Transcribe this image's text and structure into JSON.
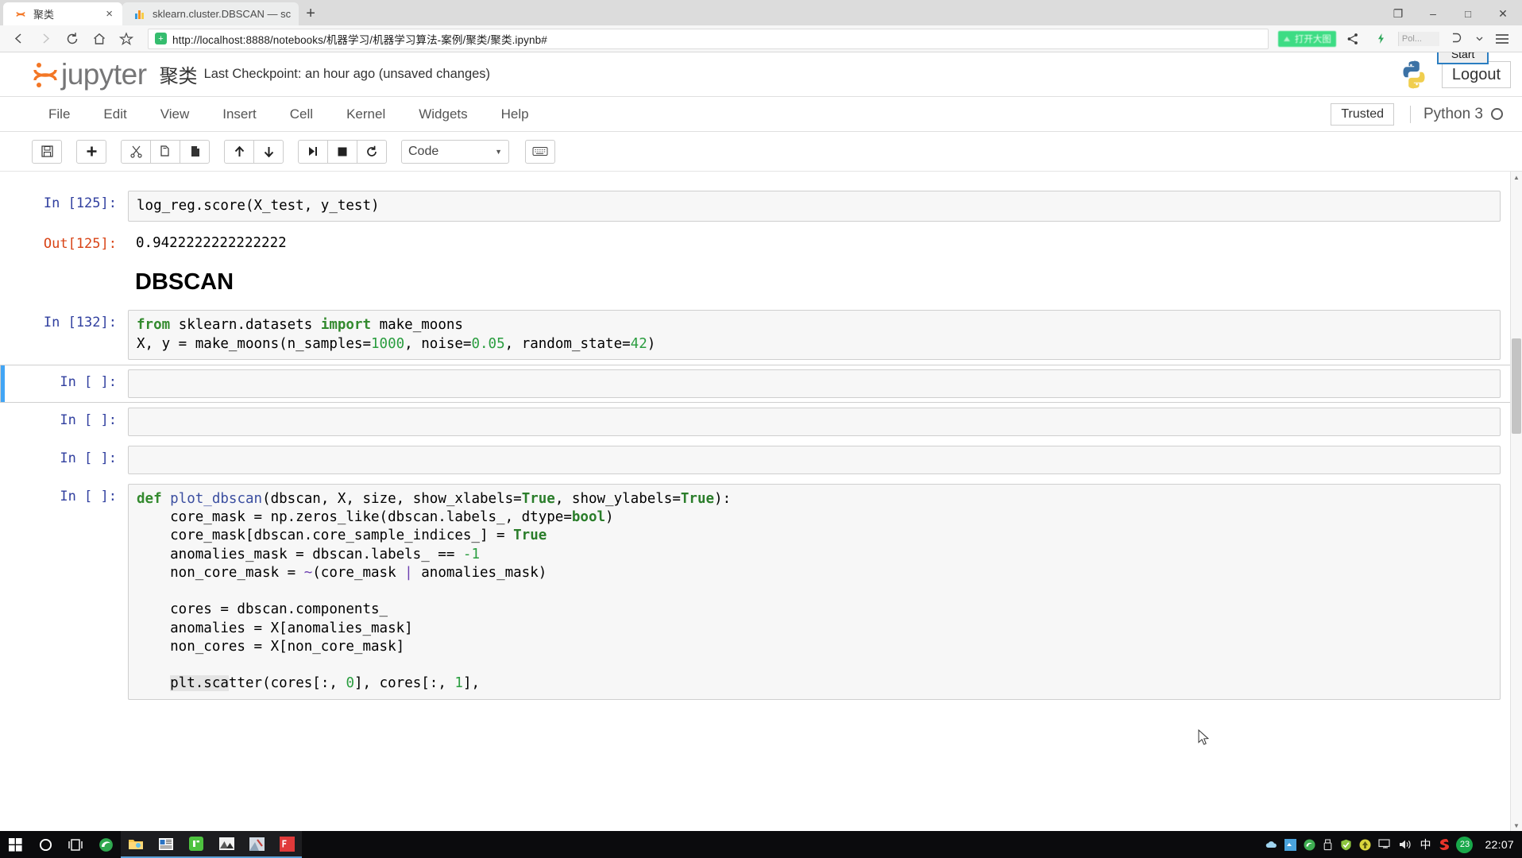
{
  "browser": {
    "tabs": [
      {
        "title": "聚类",
        "favicon": "jupyter-favicon",
        "active": true,
        "close_label": "×"
      },
      {
        "title": "sklearn.cluster.DBSCAN — sc",
        "favicon": "scikit-favicon",
        "active": false,
        "close_label": ""
      }
    ],
    "new_tab_label": "+",
    "nav": {
      "back_label": "‹",
      "forward_label": "›",
      "reload_label": "⟳",
      "home_label": "⌂",
      "bookmark_label": "☆",
      "url": "http://localhost:8888/notebooks/机器学习/机器学习算法-案例/聚类/聚类.ipynb#",
      "url_scheme": "http://",
      "url_host": "localhost",
      "url_path": ":8888/notebooks/机器学习/机器学习算法-案例/聚类/聚类.ipynb#",
      "security_icon": "shield-icon",
      "extension_badge": "打开大图",
      "share_icon": "share-icon",
      "lightning_icon": "lightning-icon",
      "pocket_label": "Pol...",
      "collections_icon": "collections-icon",
      "menu_icon": "hamburger-menu-icon"
    },
    "window_controls": {
      "restore_down": "❐",
      "minimize": "–",
      "maximize": "□",
      "close": "✕"
    }
  },
  "jupyter": {
    "logo_text": "jupyter",
    "notebook_name": "聚类",
    "checkpoint": "Last Checkpoint: an hour ago (unsaved changes)",
    "logout_label": "Logout",
    "start_tooltip": "Start",
    "menus": [
      "File",
      "Edit",
      "View",
      "Insert",
      "Cell",
      "Kernel",
      "Widgets",
      "Help"
    ],
    "trusted_label": "Trusted",
    "kernel_name": "Python 3",
    "kernel_status": "idle-circle-icon",
    "toolbar": {
      "save_icon": "save-icon",
      "insert_icon": "add-cell-icon",
      "cut_icon": "cut-icon",
      "copy_icon": "copy-icon",
      "paste_icon": "paste-icon",
      "move_up_icon": "arrow-up-icon",
      "move_down_icon": "arrow-down-icon",
      "run_icon": "run-cell-icon",
      "stop_icon": "stop-icon",
      "restart_icon": "restart-kernel-icon",
      "cell_type": "Code",
      "cell_type_caret": "▼",
      "keyboard_icon": "command-palette-icon"
    }
  },
  "notebook": {
    "cells": [
      {
        "id": "cell-score",
        "type": "code",
        "prompt": "In [125]:",
        "source": "log_reg.score(X_test, y_test)",
        "selected": false
      },
      {
        "id": "cell-score-output",
        "type": "output",
        "prompt": "Out[125]:",
        "text": "0.9422222222222222"
      },
      {
        "id": "cell-dbscan-heading",
        "type": "markdown",
        "heading": "DBSCAN"
      },
      {
        "id": "cell-make-moons",
        "type": "code",
        "prompt": "In [132]:",
        "lines": [
          "from sklearn.datasets import make_moons",
          "X, y = make_moons(n_samples=1000, noise=0.05, random_state=42)"
        ],
        "selected": false
      },
      {
        "id": "cell-empty-1",
        "type": "code",
        "prompt": "In [ ]:",
        "source": "",
        "selected": true
      },
      {
        "id": "cell-empty-2",
        "type": "code",
        "prompt": "In [ ]:",
        "source": "",
        "selected": false
      },
      {
        "id": "cell-empty-3",
        "type": "code",
        "prompt": "In [ ]:",
        "source": "",
        "selected": false
      },
      {
        "id": "cell-plot-dbscan",
        "type": "code",
        "prompt": "In [ ]:",
        "lines": [
          "def plot_dbscan(dbscan, X, size, show_xlabels=True, show_ylabels=True):",
          "    core_mask = np.zeros_like(dbscan.labels_, dtype=bool)",
          "    core_mask[dbscan.core_sample_indices_] = True",
          "    anomalies_mask = dbscan.labels_ == -1",
          "    non_core_mask = ~(core_mask | anomalies_mask)",
          "",
          "    cores = dbscan.components_",
          "    anomalies = X[anomalies_mask]",
          "    non_cores = X[non_core_mask]",
          "",
          "    plt.scatter(cores[:, 0], cores[:, 1],"
        ],
        "selected": false
      }
    ]
  },
  "taskbar": {
    "start_icon": "windows-start-icon",
    "items": [
      {
        "name": "cortana-search-icon",
        "running": false
      },
      {
        "name": "task-view-icon",
        "running": false
      },
      {
        "name": "edge-browser-icon",
        "running": false
      },
      {
        "name": "file-explorer-icon",
        "running": true
      },
      {
        "name": "news-app-icon",
        "running": true
      },
      {
        "name": "wechat-icon",
        "running": true
      },
      {
        "name": "photos-icon",
        "running": true
      },
      {
        "name": "image-viewer-icon",
        "running": true
      },
      {
        "name": "pycharm-icon",
        "running": true
      }
    ],
    "tray": [
      {
        "name": "onedrive-icon",
        "label": ""
      },
      {
        "name": "blue-app-icon",
        "label": ""
      },
      {
        "name": "green-circle-icon",
        "label": ""
      },
      {
        "name": "usb-icon",
        "label": ""
      },
      {
        "name": "security-shield-icon",
        "label": ""
      },
      {
        "name": "update-icon",
        "label": ""
      },
      {
        "name": "network-icon",
        "label": ""
      },
      {
        "name": "volume-icon",
        "label": ""
      },
      {
        "name": "ime-icon",
        "label": "中"
      },
      {
        "name": "sogou-icon",
        "label": "S"
      },
      {
        "name": "notification-count-icon",
        "label": "23"
      }
    ],
    "clock": "22:07"
  },
  "colors": {
    "jupyter_orange": "#f37726",
    "selected_cell_blue": "#42a5f5",
    "prompt_blue": "#303f9f",
    "prompt_red": "#d84315",
    "extension_green": "#3ddc84",
    "tooltip_border_blue": "#2b7ec1"
  }
}
